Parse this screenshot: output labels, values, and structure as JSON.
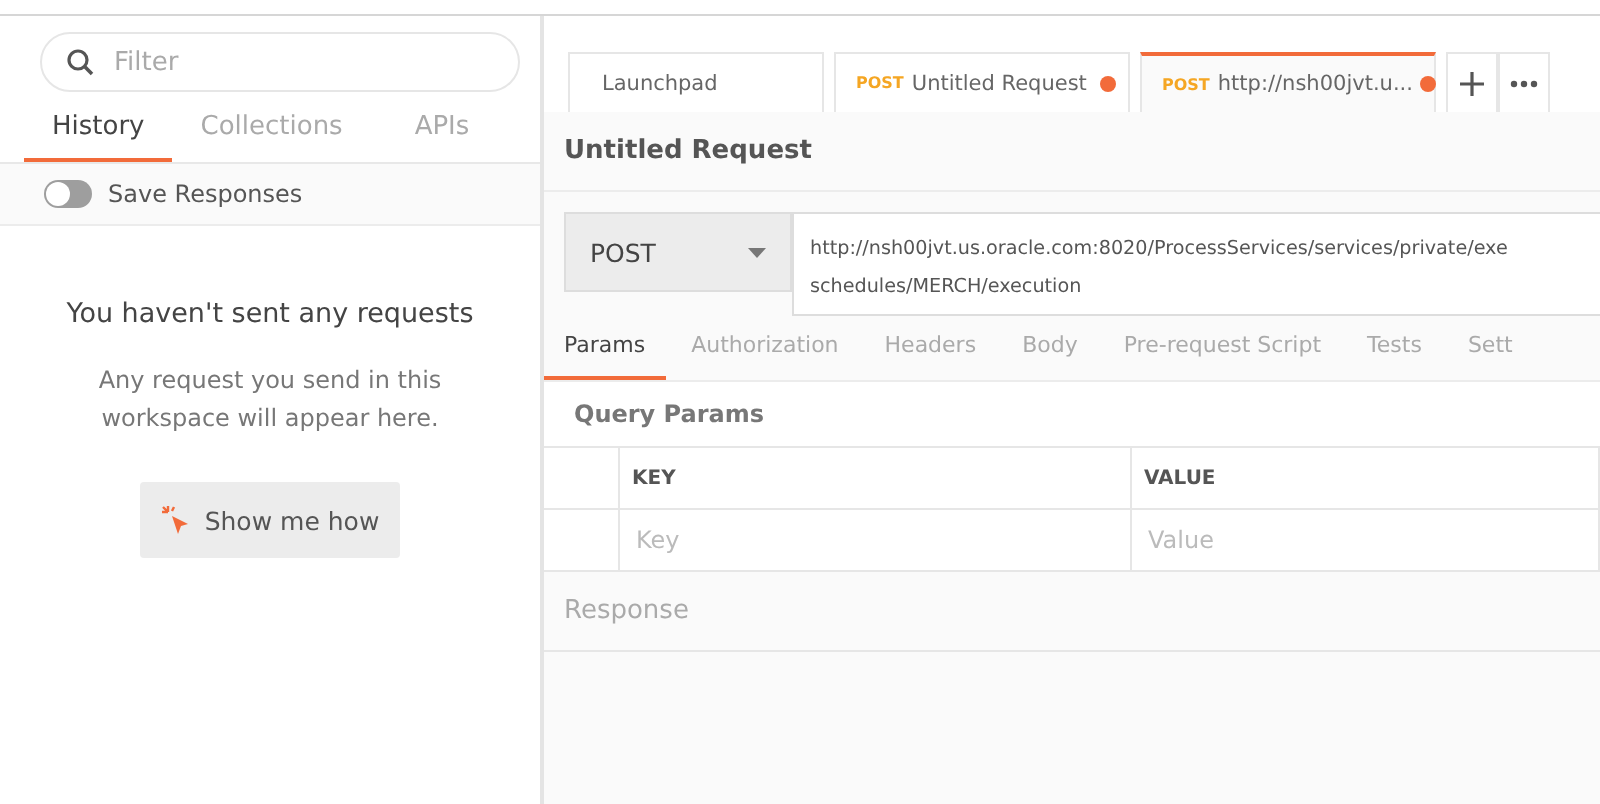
{
  "sidebar": {
    "filter": {
      "placeholder": "Filter"
    },
    "tabs": [
      {
        "label": "History",
        "selected": true
      },
      {
        "label": "Collections",
        "selected": false
      },
      {
        "label": "APIs",
        "selected": false
      }
    ],
    "save_responses": {
      "label": "Save Responses",
      "on": false
    },
    "empty": {
      "title": "You haven't sent any requests",
      "text": "Any request you send in this workspace will appear here.",
      "button": "Show me how"
    }
  },
  "tabs": [
    {
      "label": "Launchpad",
      "unsaved": false,
      "selected": false
    },
    {
      "method": "POST",
      "label": "Untitled Request",
      "unsaved": true,
      "selected": false
    },
    {
      "method": "POST",
      "label": "http://nsh00jvt.u...",
      "unsaved": true,
      "selected": true
    }
  ],
  "request": {
    "title": "Untitled Request",
    "method": "POST",
    "url_lines": [
      "http://nsh00jvt.us.oracle.com:8020/ProcessServices/services/private/exe",
      "schedules/MERCH/execution"
    ],
    "tabs": [
      {
        "label": "Params",
        "selected": true
      },
      {
        "label": "Authorization",
        "selected": false
      },
      {
        "label": "Headers",
        "selected": false
      },
      {
        "label": "Body",
        "selected": false
      },
      {
        "label": "Pre-request Script",
        "selected": false
      },
      {
        "label": "Tests",
        "selected": false
      },
      {
        "label": "Sett",
        "selected": false
      }
    ],
    "query_params": {
      "title": "Query Params",
      "columns": [
        "KEY",
        "VALUE"
      ],
      "placeholders": [
        "Key",
        "Value"
      ]
    }
  },
  "response": {
    "title": "Response"
  }
}
